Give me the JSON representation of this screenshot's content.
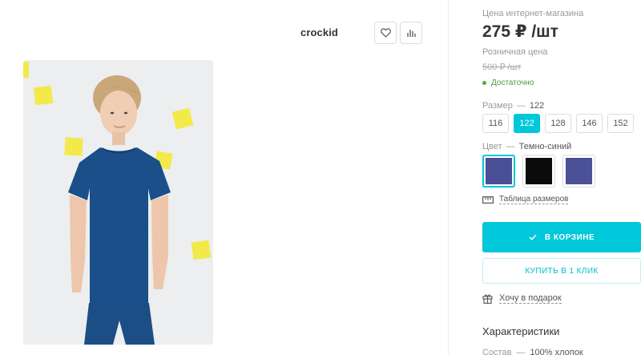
{
  "brand": {
    "logo_text": "crockid"
  },
  "actions": {
    "favorite_icon": "heart-icon",
    "compare_icon": "bar-chart-icon"
  },
  "pricing": {
    "shop_price_label": "Цена интернет-магазина",
    "shop_price": "275 ₽ /шт",
    "retail_label": "Розничная цена",
    "retail_price": "500 ₽ /шт"
  },
  "stock": {
    "text": "Достаточно",
    "color": "#4caf30"
  },
  "size": {
    "label": "Размер",
    "dash": "—",
    "selected": "122",
    "options": [
      "116",
      "122",
      "128",
      "146",
      "152"
    ]
  },
  "color": {
    "label": "Цвет",
    "dash": "—",
    "selected": "Темно-синий",
    "swatches": [
      "#4a4f96",
      "#0b0b0b",
      "#4b5097"
    ]
  },
  "size_table": {
    "text": "Таблица размеров"
  },
  "cart": {
    "label": "В КОРЗИНЕ",
    "accent": "#00c7da"
  },
  "one_click": {
    "label": "КУПИТЬ В 1 КЛИК"
  },
  "gift": {
    "text": "Хочу в подарок"
  },
  "characteristics": {
    "title": "Характеристики",
    "composition_label": "Состав",
    "composition_dash": "—",
    "composition_value": "100% хлопок"
  }
}
